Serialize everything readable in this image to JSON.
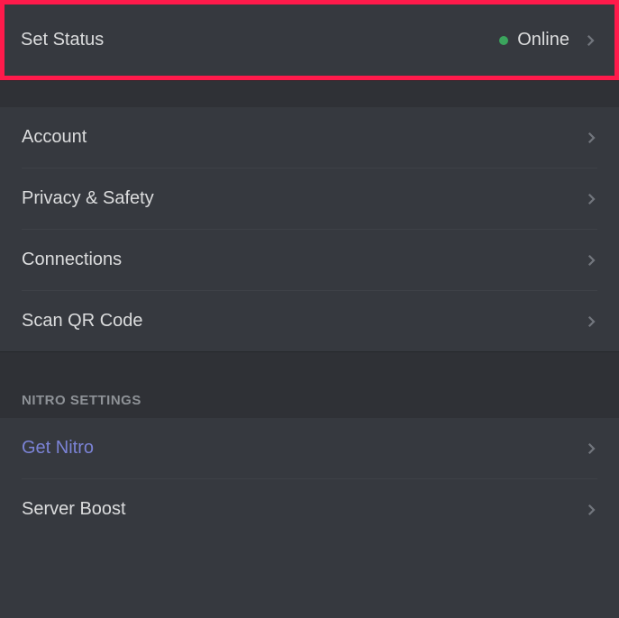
{
  "setStatus": {
    "label": "Set Status",
    "value": "Online",
    "statusColor": "#3ba55d"
  },
  "accountGroup": {
    "items": [
      {
        "label": "Account"
      },
      {
        "label": "Privacy & Safety"
      },
      {
        "label": "Connections"
      },
      {
        "label": "Scan QR Code"
      }
    ]
  },
  "nitroSection": {
    "header": "NITRO SETTINGS",
    "items": [
      {
        "label": "Get Nitro",
        "accent": true
      },
      {
        "label": "Server Boost",
        "accent": false
      }
    ]
  }
}
